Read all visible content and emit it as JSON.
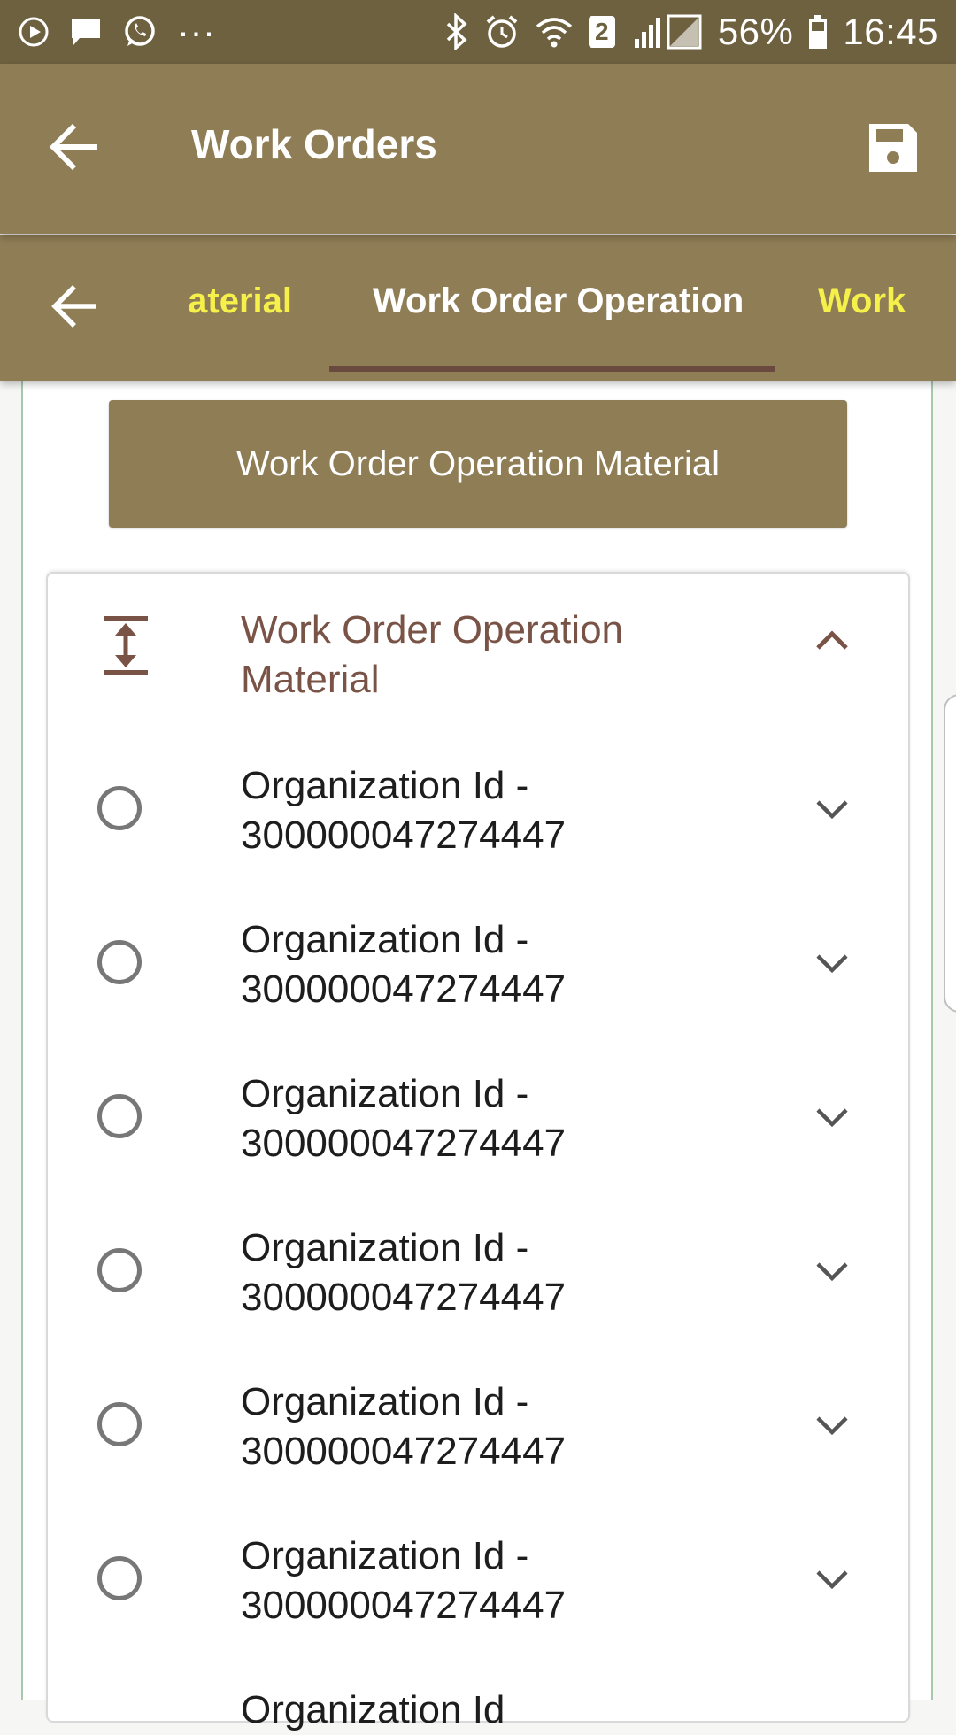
{
  "status_bar": {
    "battery_percent": "56%",
    "time": "16:45",
    "sim_badge": "2",
    "more": "···",
    "icons": [
      "play-icon",
      "message-icon",
      "whatsapp-icon",
      "bluetooth-icon",
      "alarm-icon",
      "wifi-icon",
      "signal-icon",
      "battery-icon"
    ]
  },
  "app_bar": {
    "title": "Work Orders"
  },
  "tabs": [
    {
      "label": "Work Order Operation Material",
      "visible_text": "aterial",
      "state": "inactive"
    },
    {
      "label": "Work Order Operation",
      "visible_text": "Work Order Operation",
      "state": "active"
    },
    {
      "label": "Work",
      "visible_text": "Work",
      "state": "inactive"
    }
  ],
  "section_button": {
    "label": "Work Order Operation Material"
  },
  "card": {
    "title_line1": "Work Order Operation",
    "title_line2": "Material",
    "rows": [
      {
        "line1": "Organization Id -",
        "line2": "300000047274447"
      },
      {
        "line1": "Organization Id -",
        "line2": "300000047274447"
      },
      {
        "line1": "Organization Id -",
        "line2": "300000047274447"
      },
      {
        "line1": "Organization Id -",
        "line2": "300000047274447"
      },
      {
        "line1": "Organization Id -",
        "line2": "300000047274447"
      },
      {
        "line1": "Organization Id -",
        "line2": "300000047274447"
      },
      {
        "line1": "Organization Id",
        "line2": ""
      }
    ]
  },
  "colors": {
    "status_bar": "#6e6140",
    "app_bar": "#8f7d55",
    "inactive_tab_text": "#f5f04a",
    "tab_indicator": "#6a4a3e",
    "card_title": "#7a5347"
  }
}
